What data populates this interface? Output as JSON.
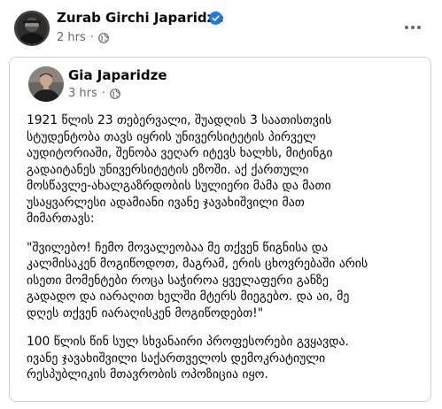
{
  "post": {
    "author": "Zurab Girchi Japaridze",
    "time": "2 hrs",
    "separator": "·",
    "verified": true,
    "privacy_icon": "globe-icon",
    "more_icon": "more-options-icon"
  },
  "shared": {
    "author": "Gia Japaridze",
    "time": "3 hrs",
    "separator": "·",
    "privacy_icon": "globe-icon",
    "paragraphs": [
      "1921 წლის 23 თებერვალი, შუადღის 3 საათისთვის\nსტუდენტობა თავს იყრის უნივერსიტეტის პირველ\nაუდიტორიაში, შენობა ვეღარ იტევს ხალხს, მიტინგი\nგადაიტანეს უნივერსიტეტის ეზოში. აქ ქართული\nმოსწავლე-ახალგაზრდობის სულიერი მამა და მათი\nუსაყვარლესი ადამიანი ივანე ჯავახიშვილი მათ\nმიმართავს:",
      "\"შვილებო! ჩემო მოვალეობაა მე თქვენ წიგნისა და\nკალმისაკენ მოგიწოდოთ, მაგრამ, ერის ცხოვრებაში არის\nისეთი მომენტები როცა საჭიროა ყველაფერი განზე\nგადადო და იარაღით ხელში მტერს მიეგებო. და აი, მე\nდღეს თქვენ იარაღისკენ მოგიწოდებთ!\"",
      "100 წლის წინ სულ სხვანაირი პროფესორები გვყავდა.\nივანე ჯავახიშვილი საქართველოს დემოკრატიული\nრესპუბლიკის მთავრობის ოპოზიცია იყო."
    ]
  },
  "colors": {
    "text": "#050505",
    "secondary_text": "#65676b",
    "verified_badge": "#1877f2",
    "border": "#ced0d4"
  }
}
